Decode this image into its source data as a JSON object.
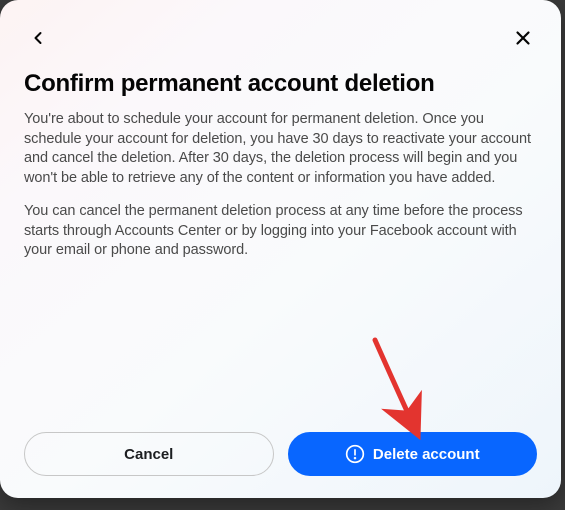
{
  "dialog": {
    "title": "Confirm permanent account deletion",
    "paragraph1": "You're about to schedule your account for permanent deletion. Once you schedule your account for deletion, you have 30 days to reactivate your account and cancel the deletion. After 30 days, the deletion process will begin and you won't be able to retrieve any of the content or information you have added.",
    "paragraph2": "You can cancel the permanent deletion process at any time before the process starts through Accounts Center or by logging into your Facebook account with your email or phone and password.",
    "cancel_label": "Cancel",
    "delete_label": "Delete account"
  },
  "annotation": {
    "arrow_points_to": "delete-account-button",
    "color": "#e3342f"
  }
}
